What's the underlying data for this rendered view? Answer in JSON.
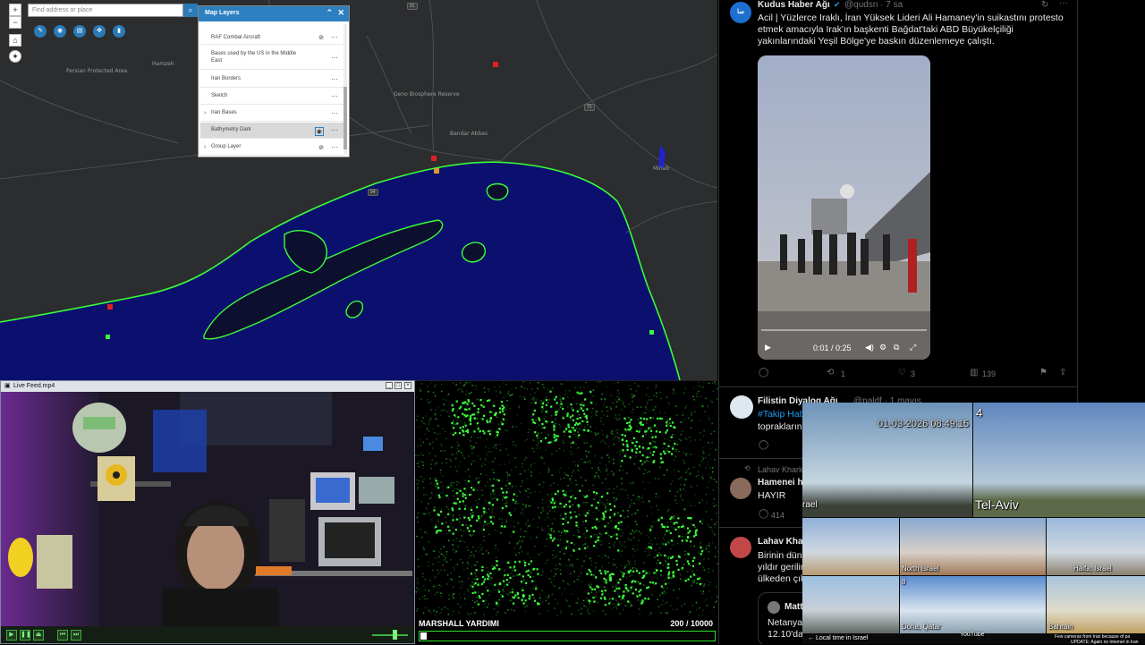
{
  "map": {
    "search_placeholder": "Find address or place",
    "layers_title": "Map Layers",
    "layers": [
      {
        "label": "RAF Combat Aircraft",
        "expandable": false
      },
      {
        "label": "Bases used by the US in the Middle East",
        "expandable": false
      },
      {
        "label": "Iran Borders",
        "expandable": false
      },
      {
        "label": "Sketch",
        "expandable": false
      },
      {
        "label": "Iran Bases",
        "expandable": true
      },
      {
        "label": "Bathymetry Dark",
        "expandable": false,
        "selected": true
      },
      {
        "label": "Group Layer",
        "expandable": true
      }
    ],
    "place_labels": [
      "Persian Protected Area",
      "Hamzeh",
      "Bandar Abbas",
      "Geno Biosphere Reserve",
      "Minab"
    ],
    "highway_numbers": [
      "91",
      "71",
      "94"
    ],
    "coast_color": "#39ff3a",
    "water_color": "#0b0f6e"
  },
  "player": {
    "window_title": "Live Feed.mp4",
    "accent": "#3fae3f"
  },
  "matrix": {
    "title": "MARSHALL YARDIMI",
    "count_current": "200",
    "count_total": "/ 10000",
    "progress": 0.02
  },
  "feed": {
    "tweet1": {
      "name": "Kudus Haber Ağı",
      "handle": "@qudsn · 7 sa",
      "text": "Acil | Yüzlerce Iraklı, İran Yüksek Lideri Ali Hamaney'in suikastını protesto etmek amacıyla Irak'ın başkenti Bağdat'taki ABD Büyükelçiliği yakınlarındaki Yeşil Bölge'ye baskın düzenlemeye çalıştı.",
      "video_time": "0:01 / 0:25",
      "retweets": "1",
      "likes": "3",
      "views": "139"
    },
    "tweet2": {
      "name": "Filistin Diyalog Ağı",
      "handle": "@paldf · 1 mayıs",
      "hashtag": "#Takip Hab",
      "text_cont": "topraklarını"
    },
    "reply_context": "Lahav Khark",
    "tweet3": {
      "name": "Hamenei h",
      "text": "HAYIR",
      "likes": "414"
    },
    "tweet4": {
      "name": "Lahav Khal",
      "text_lines": [
        "Birinin dün",
        "yıldır gerilim",
        "ülkeden çık"
      ]
    },
    "tweet5": {
      "name": "Matt",
      "text_lines": [
        "Netanyah",
        "12.10'da"
      ]
    }
  },
  "cams": {
    "timestamp": "01-03-2026 08:49:15",
    "cam1_no": "4",
    "cam_srael": "rael",
    "labels": [
      "Tel-Aviv",
      "North Israel",
      "Haifa, Israel",
      "Doha, Qatar",
      "Bahrain"
    ],
    "cam_no_8": "8",
    "bottom_left": "← Local time in Israel",
    "youtube": "YouTube",
    "bottom_right": "Few cameras from Iran because of pa",
    "bottom_right2": "UPDATE: Again no internet in Iran"
  }
}
